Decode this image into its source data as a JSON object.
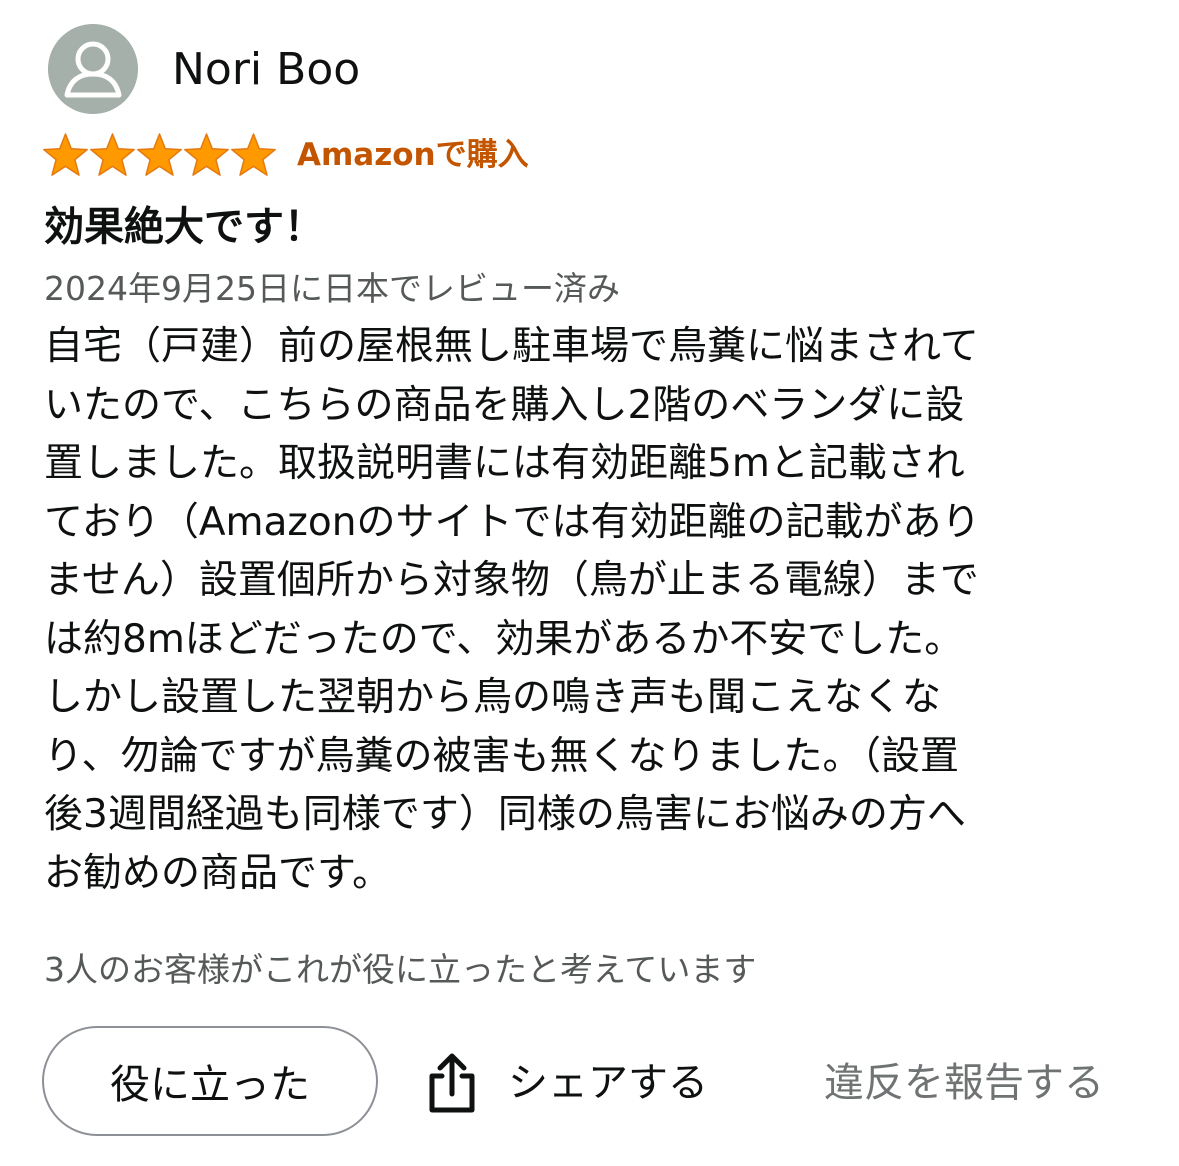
{
  "reviewer": {
    "name": "Nori Boo",
    "avatar_icon": "default-user-avatar-icon"
  },
  "rating": {
    "value": 5,
    "max": 5,
    "star_icon": "star-icon",
    "star_color": "#ff9900"
  },
  "verified_purchase": "Amazonで購入",
  "verified_color": "#c45500",
  "review": {
    "title": "効果絶大です！",
    "date": "2024年9月25日に日本でレビュー済み",
    "body_lines": [
      "自宅（戸建）前の屋根無し駐車場で鳥糞に悩まされて",
      "いたので、こちらの商品を購入し2階のベランダに設",
      "置しました。取扱説明書には有効距離5mと記載され",
      "ており（Amazonのサイトでは有効距離の記載があり",
      "ません）設置個所から対象物（鳥が止まる電線）まで",
      "は約8mほどだったので、効果があるか不安でした。",
      "しかし設置した翌朝から鳥の鳴き声も聞こえなくな",
      "り、勿論ですが鳥糞の被害も無くなりました。（設置",
      "後3週間経過も同様です）同様の鳥害にお悩みの方へ",
      "お勧めの商品です。"
    ]
  },
  "helpful_count_text": "3人のお客様がこれが役に立ったと考えています",
  "actions": {
    "helpful_label": "役に立った",
    "share_label": "シェアする",
    "share_icon": "share-icon",
    "report_label": "違反を報告する"
  }
}
